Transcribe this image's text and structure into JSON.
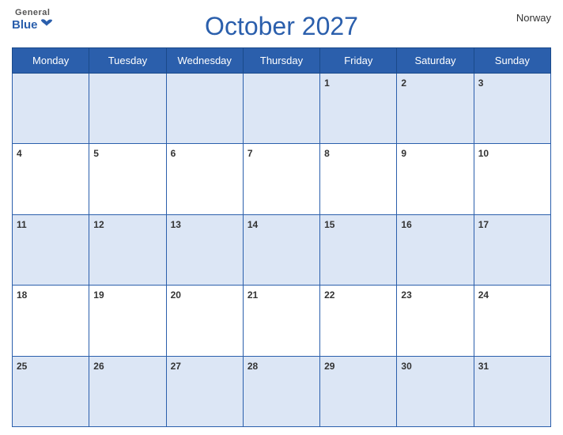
{
  "app": {
    "name_general": "General",
    "name_blue": "Blue",
    "country": "Norway"
  },
  "calendar": {
    "title": "October 2027",
    "days_of_week": [
      "Monday",
      "Tuesday",
      "Wednesday",
      "Thursday",
      "Friday",
      "Saturday",
      "Sunday"
    ],
    "weeks": [
      [
        null,
        null,
        null,
        null,
        1,
        2,
        3
      ],
      [
        4,
        5,
        6,
        7,
        8,
        9,
        10
      ],
      [
        11,
        12,
        13,
        14,
        15,
        16,
        17
      ],
      [
        18,
        19,
        20,
        21,
        22,
        23,
        24
      ],
      [
        25,
        26,
        27,
        28,
        29,
        30,
        31
      ]
    ]
  }
}
